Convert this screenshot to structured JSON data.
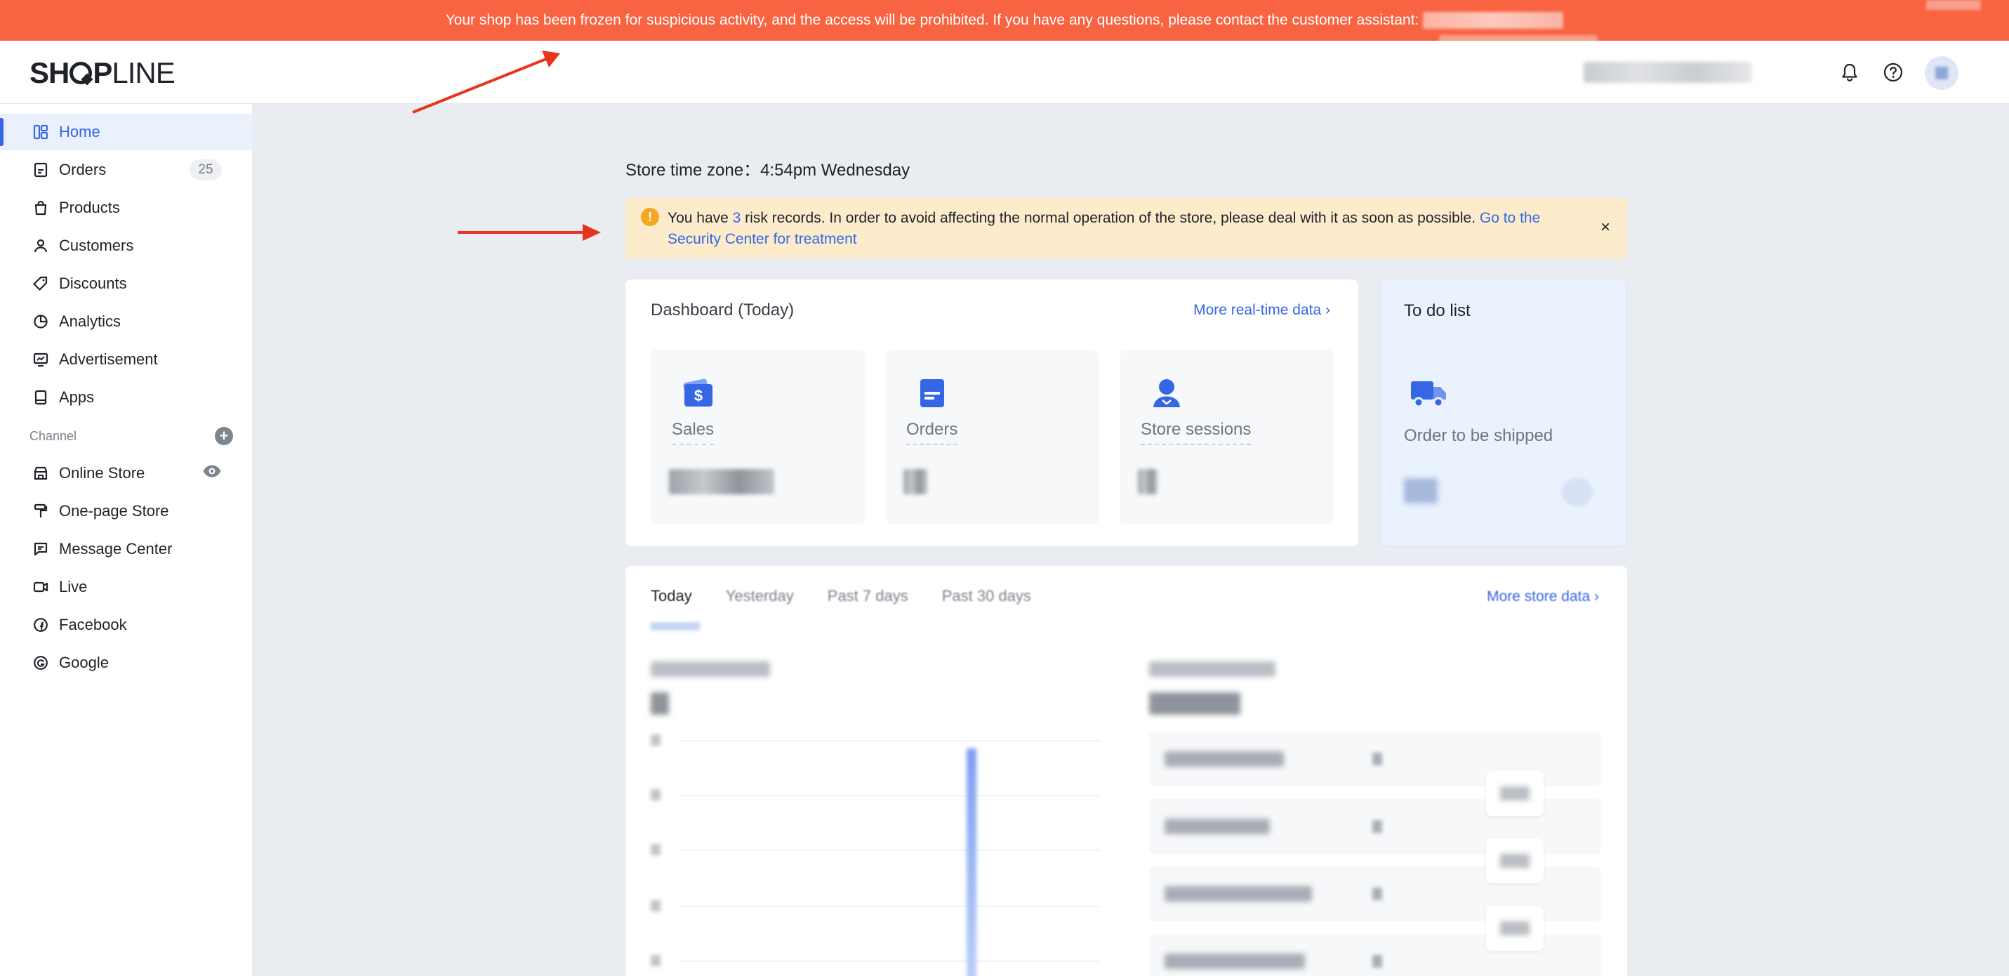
{
  "banner": {
    "message": "Your shop has been frozen for suspicious activity, and the access will be prohibited. If you have any questions, please contact the customer assistant:"
  },
  "header": {
    "logo_bold": "SH",
    "logo_after_o": "P",
    "logo_thin": "LINE"
  },
  "sidebar": {
    "items": [
      {
        "label": "Home",
        "icon": "dashboard-icon"
      },
      {
        "label": "Orders",
        "icon": "order-document-icon",
        "badge": "25"
      },
      {
        "label": "Products",
        "icon": "shopping-bag-icon"
      },
      {
        "label": "Customers",
        "icon": "person-icon"
      },
      {
        "label": "Discounts",
        "icon": "tag-icon"
      },
      {
        "label": "Analytics",
        "icon": "pie-chart-icon"
      },
      {
        "label": "Advertisement",
        "icon": "monitor-chart-icon"
      },
      {
        "label": "Apps",
        "icon": "app-tablet-icon"
      }
    ],
    "channel_label": "Channel",
    "channels": [
      {
        "label": "Online Store",
        "icon": "storefront-icon"
      },
      {
        "label": "One-page Store",
        "icon": "paint-roller-icon"
      },
      {
        "label": "Message Center",
        "icon": "chat-icon"
      },
      {
        "label": "Live",
        "icon": "video-camera-icon"
      },
      {
        "label": "Facebook",
        "icon": "facebook-icon"
      },
      {
        "label": "Google",
        "icon": "google-icon"
      }
    ]
  },
  "main": {
    "timezone": "Store time zone：4:54pm Wednesday",
    "alert": {
      "prefix": "You have ",
      "count": "3",
      "middle": " risk records. In order to avoid affecting the normal operation of the store, please deal with it as soon as possible. ",
      "link": "Go to the Security Center for treatment",
      "close": "×"
    },
    "dashboard": {
      "title": "Dashboard (Today)",
      "more": "More real-time data",
      "metrics": [
        {
          "label": "Sales",
          "icon": "wallet-dollar-icon"
        },
        {
          "label": "Orders",
          "icon": "document-icon"
        },
        {
          "label": "Store sessions",
          "icon": "user-icon"
        }
      ]
    },
    "todo": {
      "title": "To do list",
      "item_label": "Order to be shipped",
      "icon": "truck-icon"
    },
    "store_data": {
      "tabs": [
        "Today",
        "Yesterday",
        "Past 7 days",
        "Past 30 days"
      ],
      "more": "More store data"
    }
  },
  "colors": {
    "banner": "#f86342",
    "accent": "#3567e5",
    "alert_bg": "#fdeccc",
    "annotation_arrow": "#e8341c"
  }
}
